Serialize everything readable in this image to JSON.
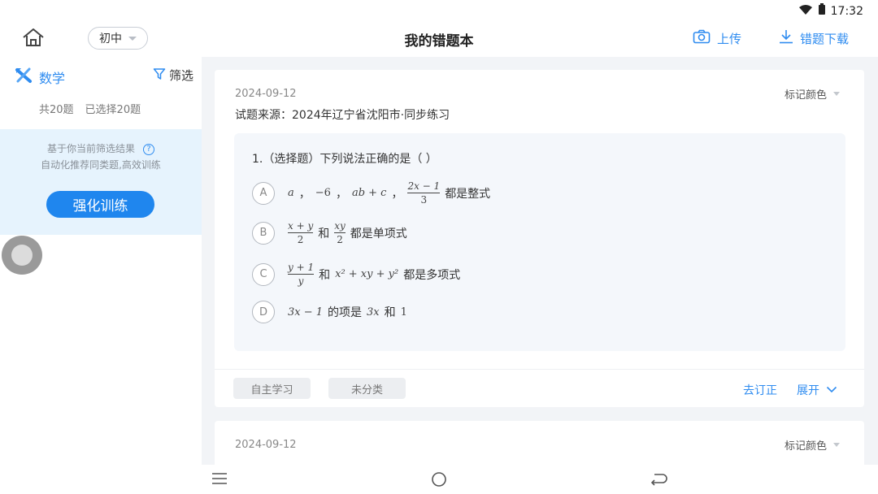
{
  "status": {
    "time": "17:32"
  },
  "header": {
    "grade": "初中",
    "title": "我的错题本",
    "upload_label": "上传",
    "download_label": "错题下载"
  },
  "sidebar": {
    "subject": "数学",
    "filter_label": "筛选",
    "total": "共20题",
    "selected": "已选择20题",
    "recommend_line1": "基于你当前筛选结果",
    "recommend_line2": "自动化推荐同类题,高效训练",
    "train_button": "强化训练"
  },
  "cards": [
    {
      "date": "2024-09-12",
      "mark_color": "标记颜色",
      "source": "试题来源：2024年辽宁省沈阳市·同步练习",
      "question": "1.（选择题）下列说法正确的是（    ）",
      "options": [
        {
          "letter": "A",
          "m1": "a",
          "m2": "−6",
          "m3": "ab + c",
          "num": "2x − 1",
          "den": "3",
          "text": "都是整式"
        },
        {
          "letter": "B",
          "num1": "x + y",
          "den1": "2",
          "and": "和",
          "num2": "xy",
          "den2": "2",
          "text": "都是单项式"
        },
        {
          "letter": "C",
          "num": "y + 1",
          "den": "y",
          "and": "和",
          "expr": "x² + xy + y²",
          "text": "都是多项式"
        },
        {
          "letter": "D",
          "expr1": "3x − 1",
          "mid": "的项是",
          "expr2": "3x",
          "and": "和",
          "expr3": "1"
        }
      ],
      "tags": [
        "自主学习",
        "未分类"
      ],
      "fix_label": "去订正",
      "expand_label": "展开"
    },
    {
      "date": "2024-09-12",
      "mark_color": "标记颜色"
    }
  ],
  "colors": {
    "accent": "#2f8cf0",
    "train_button": "#1f86ee",
    "recommend_bg": "#e6f3fd"
  }
}
